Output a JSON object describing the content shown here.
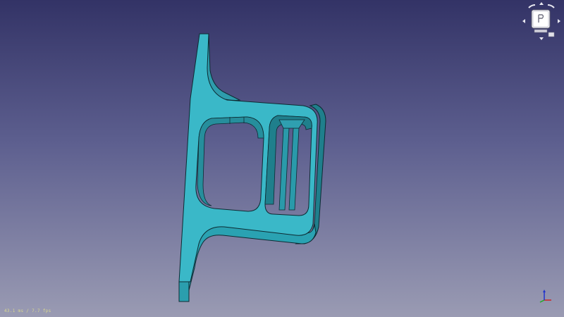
{
  "viewport": {
    "fps_readout": "43.1 ms / 7.7 fps",
    "background_top": "#333366",
    "background_bottom": "#9a9bb3"
  },
  "model": {
    "face_color": "#3ab8c8",
    "edge_color": "#0d2a32"
  },
  "navigation_cube": {
    "face_icon": "navcube-front-face-icon",
    "arrows": [
      "rotate-up-icon",
      "rotate-down-icon",
      "rotate-left-icon",
      "rotate-right-icon"
    ],
    "menu_icon": "navcube-menu-icon"
  },
  "axis_cross": {
    "icon": "axis-cross-icon",
    "x_color": "#cc2222",
    "y_color": "#22aa22",
    "z_color": "#2233cc"
  }
}
